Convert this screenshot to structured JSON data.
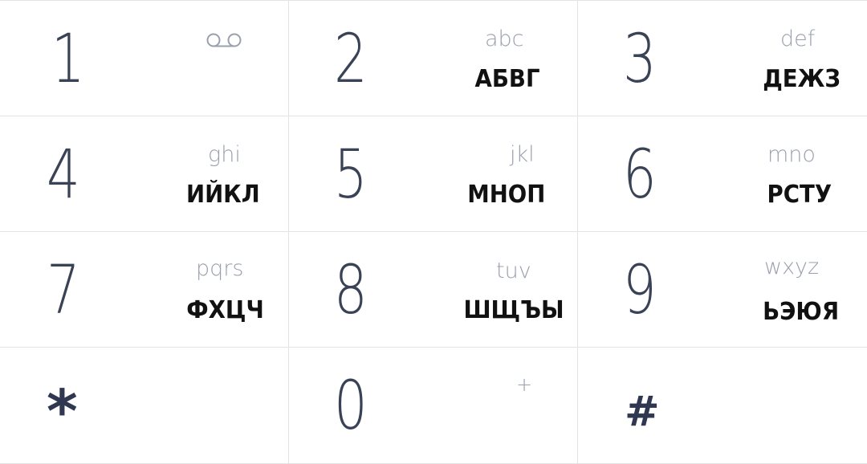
{
  "keys": [
    {
      "digit": "1",
      "latin": "",
      "cyr": "",
      "icon": "voicemail-icon"
    },
    {
      "digit": "2",
      "latin": "abc",
      "cyr": "АБВГ"
    },
    {
      "digit": "3",
      "latin": "def",
      "cyr": "ДЕЖЗ"
    },
    {
      "digit": "4",
      "latin": "ghi",
      "cyr": "ИЙКЛ"
    },
    {
      "digit": "5",
      "latin": "jkl",
      "cyr": "МНОП"
    },
    {
      "digit": "6",
      "latin": "mno",
      "cyr": "РСТУ"
    },
    {
      "digit": "7",
      "latin": "pqrs",
      "cyr": "ФХЦЧ"
    },
    {
      "digit": "8",
      "latin": "tuv",
      "cyr": "ШЩЪЫ"
    },
    {
      "digit": "9",
      "latin": "wxyz",
      "cyr": "ЬЭЮЯ"
    },
    {
      "digit": "*",
      "latin": "",
      "cyr": ""
    },
    {
      "digit": "0",
      "latin": "+",
      "cyr": ""
    },
    {
      "digit": "#",
      "latin": "",
      "cyr": ""
    }
  ],
  "colors": {
    "digit": "#3a4256",
    "latin": "#9aa0ad",
    "cyrillic": "#111111",
    "divider": "#e3e3e3",
    "background": "#ffffff"
  }
}
